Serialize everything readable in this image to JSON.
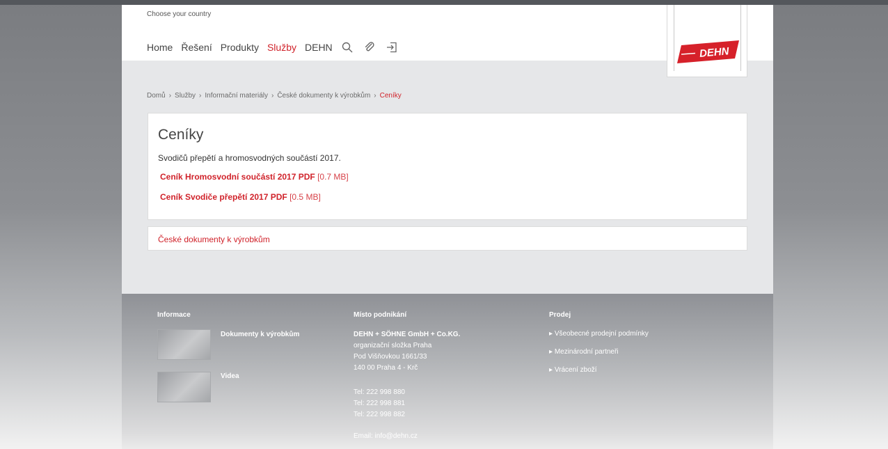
{
  "header": {
    "choose_country": "Choose your country",
    "nav": [
      "Home",
      "Řešení",
      "Produkty",
      "Služby",
      "DEHN"
    ],
    "active_nav": "Služby",
    "logo_text": "DEHN",
    "icons": [
      "search-icon",
      "paperclip-icon",
      "login-icon"
    ]
  },
  "breadcrumb": [
    "Domů",
    "Služby",
    "Informační materiály",
    "České dokumenty k výrobkům",
    "Ceníky"
  ],
  "content": {
    "title": "Ceníky",
    "description": "Svodičů přepětí a hromosvodných součástí 2017.",
    "documents": [
      {
        "name": "Ceník Hromosvodní součástí 2017 PDF",
        "size": "[0.7 MB]"
      },
      {
        "name": "Ceník Svodiče přepětí 2017 PDF",
        "size": "[0.5 MB]"
      }
    ],
    "related_link": "České dokumenty k výrobkům"
  },
  "footer": {
    "info": {
      "heading": "Informace",
      "items": [
        "Dokumenty k výrobkům",
        "Videa"
      ]
    },
    "business": {
      "heading": "Místo podnikání",
      "company": "DEHN + SÖHNE GmbH + Co.KG.",
      "lines": [
        "organizační složka Praha",
        "Pod Višňovkou 1661/33",
        "140 00 Praha 4 - Krč"
      ],
      "phones": [
        "Tel: 222 998 880",
        "Tel: 222 998 881",
        "Tel: 222 998 882"
      ],
      "email": "Email: info@dehn.cz"
    },
    "sales": {
      "heading": "Prodej",
      "items": [
        "Všeobecné prodejní podmínky",
        "Mezinárodní partneři",
        "Vrácení zboží"
      ]
    }
  },
  "colors": {
    "accent": "#d0222a",
    "page_bg": "#e6e7e9"
  }
}
